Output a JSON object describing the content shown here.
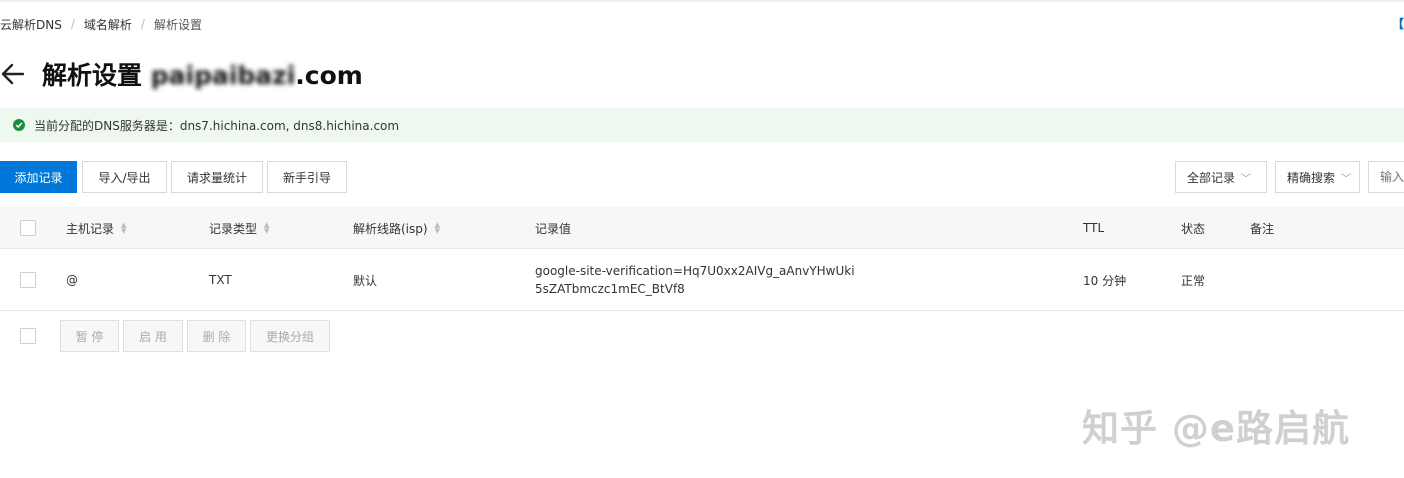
{
  "breadcrumb": {
    "items": [
      "云解析DNS",
      "域名解析",
      "解析设置"
    ],
    "separator": "/"
  },
  "corner_link": "【C",
  "header": {
    "title": "解析设置",
    "domain_hidden": "paipaibazi",
    "domain_suffix": ".com"
  },
  "notice": {
    "text": "当前分配的DNS服务器是：dns7.hichina.com, dns8.hichina.com"
  },
  "toolbar": {
    "add_record": "添加记录",
    "import_export": "导入/导出",
    "request_stats": "请求量统计",
    "beginner_guide": "新手引导"
  },
  "filters": {
    "record_filter": "全部记录",
    "search_mode": "精确搜索",
    "search_placeholder": "输入"
  },
  "table": {
    "columns": {
      "host": "主机记录",
      "type": "记录类型",
      "line": "解析线路(isp)",
      "value": "记录值",
      "ttl": "TTL",
      "status": "状态",
      "remark": "备注"
    },
    "rows": [
      {
        "host": "@",
        "type": "TXT",
        "line": "默认",
        "value": "google-site-verification=Hq7U0xx2AIVg_aAnvYHwUki5sZATbmczc1mEC_BtVf8",
        "ttl": "10 分钟",
        "status": "正常",
        "remark": ""
      }
    ]
  },
  "batch": {
    "pause": "暂 停",
    "enable": "启 用",
    "delete": "删 除",
    "change_group": "更换分组"
  },
  "watermark": "知乎 @e路启航",
  "colors": {
    "primary": "#0077d9",
    "success": "#1e8e3e",
    "notice_bg": "#eef8ee"
  }
}
